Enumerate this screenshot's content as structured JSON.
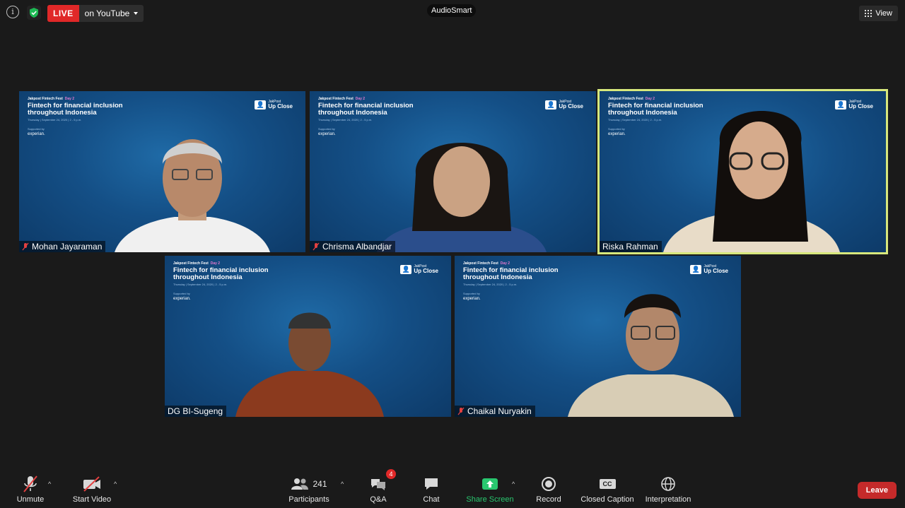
{
  "top": {
    "live_label": "LIVE",
    "live_target": "on YouTube",
    "app_title": "AudioSmart",
    "view_label": "View",
    "icons": [
      "info-icon",
      "shield-check-icon",
      "caret-down-icon",
      "grid-icon"
    ],
    "colors": {
      "live": "#e02828",
      "shield": "#1db954"
    }
  },
  "banner": {
    "tag": "Jakpost Fintech Fest",
    "tag_day": "Day 2",
    "headline_1": "Fintech for financial inclusion",
    "headline_2": "throughout Indonesia",
    "date": "Thursday  |  September 24, 2020  |  2 - 5 p.m.",
    "supported_by": "Supported by",
    "sponsor": "experian.",
    "logo_top": "JakPost",
    "logo_main": "Up Close"
  },
  "participants": [
    {
      "name": "Mohan Jayaraman",
      "muted": true,
      "active": false
    },
    {
      "name": "Chrisma Albandjar",
      "muted": true,
      "active": false
    },
    {
      "name": "Riska Rahman",
      "muted": false,
      "active": true
    },
    {
      "name": "DG BI-Sugeng",
      "muted": false,
      "active": false
    },
    {
      "name": "Chaikal Nuryakin",
      "muted": true,
      "active": false
    }
  ],
  "toolbar": {
    "unmute": "Unmute",
    "start_video": "Start Video",
    "participants": "Participants",
    "participant_count": "241",
    "qa": "Q&A",
    "qa_badge": "4",
    "chat": "Chat",
    "share_screen": "Share Screen",
    "record": "Record",
    "closed_caption": "Closed Caption",
    "cc_glyph": "CC",
    "interpretation": "Interpretation",
    "leave": "Leave",
    "colors": {
      "share": "#29c76f",
      "leave": "#c52a2a"
    }
  }
}
